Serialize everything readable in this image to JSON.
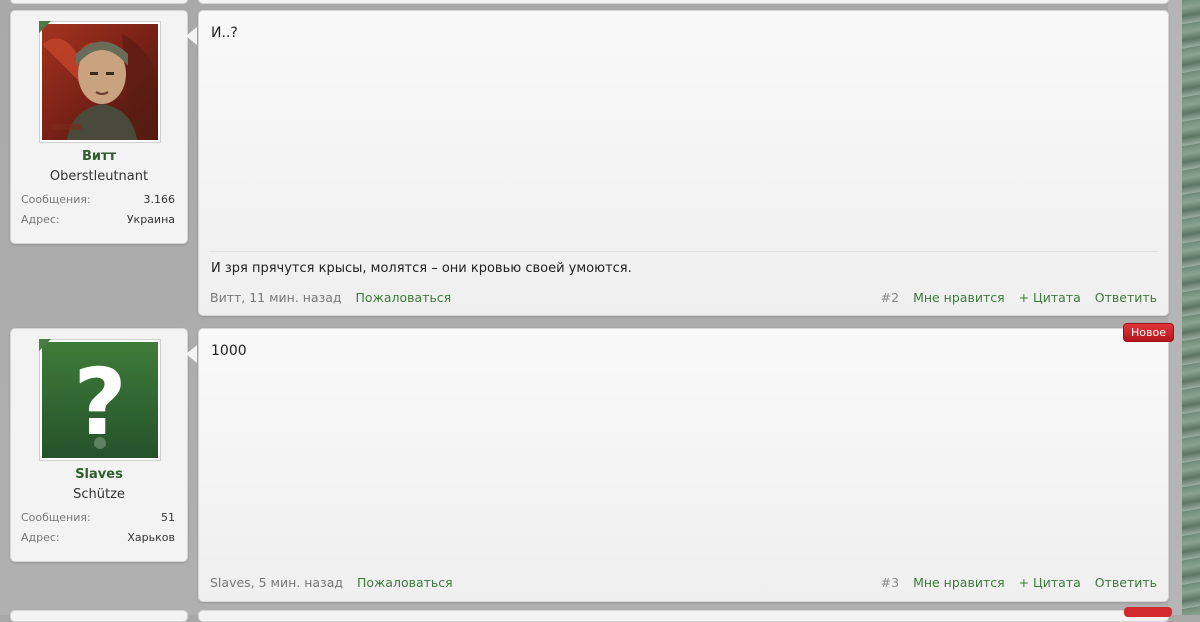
{
  "posts": [
    {
      "author": {
        "name": "Витт",
        "title": "Oberstleutnant",
        "stats": [
          {
            "label": "Сообщения:",
            "value": "3.166"
          },
          {
            "label": "Адрес:",
            "value": "Украина"
          }
        ]
      },
      "message": "И..?",
      "signature": "И зря прячутся крысы, молятся – они кровью своей умоются.",
      "meta": {
        "author": "Витт",
        "time": ", 11 мин. назад",
        "report": "Пожаловаться"
      },
      "actions": {
        "number": "#2",
        "like": "Мне нравится",
        "quote": "+ Цитата",
        "reply": "Ответить"
      }
    },
    {
      "author": {
        "name": "Slaves",
        "title": "Schütze",
        "stats": [
          {
            "label": "Сообщения:",
            "value": "51"
          },
          {
            "label": "Адрес:",
            "value": "Харьков"
          }
        ]
      },
      "badge": "Новое",
      "message": "1000",
      "meta": {
        "author": "Slaves",
        "time": ", 5 мин. назад",
        "report": "Пожаловаться"
      },
      "actions": {
        "number": "#3",
        "like": "Мне нравится",
        "quote": "+ Цитата",
        "reply": "Ответить"
      }
    }
  ],
  "colors": {
    "link": "#3d7a3b",
    "username": "#2f5d2b",
    "badge": "#d12a2f"
  },
  "icons": {
    "avatar_2": "question-mark-icon"
  }
}
